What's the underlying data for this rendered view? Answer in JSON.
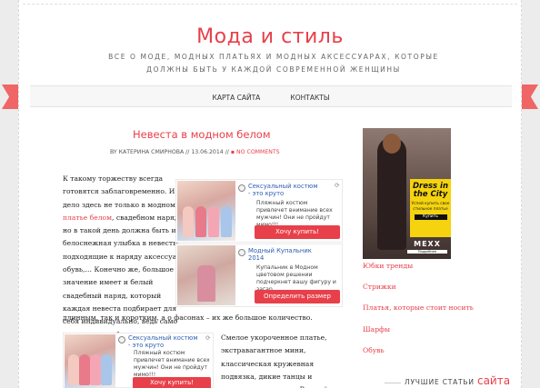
{
  "header": {
    "site_title": "Мода и стиль",
    "tagline": "Все о моде, модных платьях и модных аксессуарах, которые должны быть у каждой современной женщины"
  },
  "nav": {
    "items": [
      "Карта сайта",
      "Контакты"
    ]
  },
  "post": {
    "title": "Невеста в модном белом",
    "meta": {
      "by_prefix": "By",
      "author": "Катерина Смирнова",
      "separator": "//",
      "date": "13.06.2014",
      "comments": "No Comments"
    },
    "body_part1": "К такому торжеству всегда готовятся заблаговременно. И дело здесь не только в модном ",
    "body_link": "платье белом",
    "body_part2": ", свадебном наряде, но в такой день должна быть и белоснежная улыбка в невесты, подходящие к наряду аксессуары, обувь,… Конечно же, большое значение имеет и белый свадебный наряд, который каждая невеста подбирает для себя индивидуально, ведь само платье может быть, как",
    "body_tail": "длинным, так и коротким, а о фасонах – их же большое количество.",
    "body_right": "Смелое укороченное платье, экстравагантное мини, классическая кружевная подвязка, дикие танцы и конкурсы на грани… В такой"
  },
  "ads": [
    {
      "title": "Сексуальный костюм - это круто",
      "desc": "Пляжный костюм привлечет внимание всех мужчин! Они не пройдут мимо!!!",
      "button": "Хочу купить!"
    },
    {
      "title": "Модный Купальник 2014",
      "desc": "Купальник в Модном цветовом решении подчеркнет вашу фигуру и загар.",
      "button": "Определить размер"
    },
    {
      "title": "Сексуальный костюм - это круто",
      "desc": "Пляжный костюм привлечет внимание всех мужчин! Они не пройдут мимо!!!",
      "button": "Хочу купить!"
    }
  ],
  "banner": {
    "headline": "Dress in the City",
    "subtext": "Успей купить свое стильное платье",
    "cta": "Купить",
    "brand": "MEXX",
    "brand_sub": "Подробнее"
  },
  "sidebar": {
    "links": [
      "Юбки тренды",
      "Стрижки",
      "Платья, которые стоит носить",
      "Шарфы",
      "Обувь"
    ],
    "best_heading_prefix": "Лучшие статьи",
    "best_heading_accent": "сайта"
  },
  "colors": {
    "accent": "#e8404a",
    "ad_link": "#2a5db0",
    "banner_yellow": "#f5d30e"
  },
  "icons": {
    "ad_info": "info-icon",
    "ad_refresh": "refresh-icon",
    "comments": "comment-icon"
  }
}
